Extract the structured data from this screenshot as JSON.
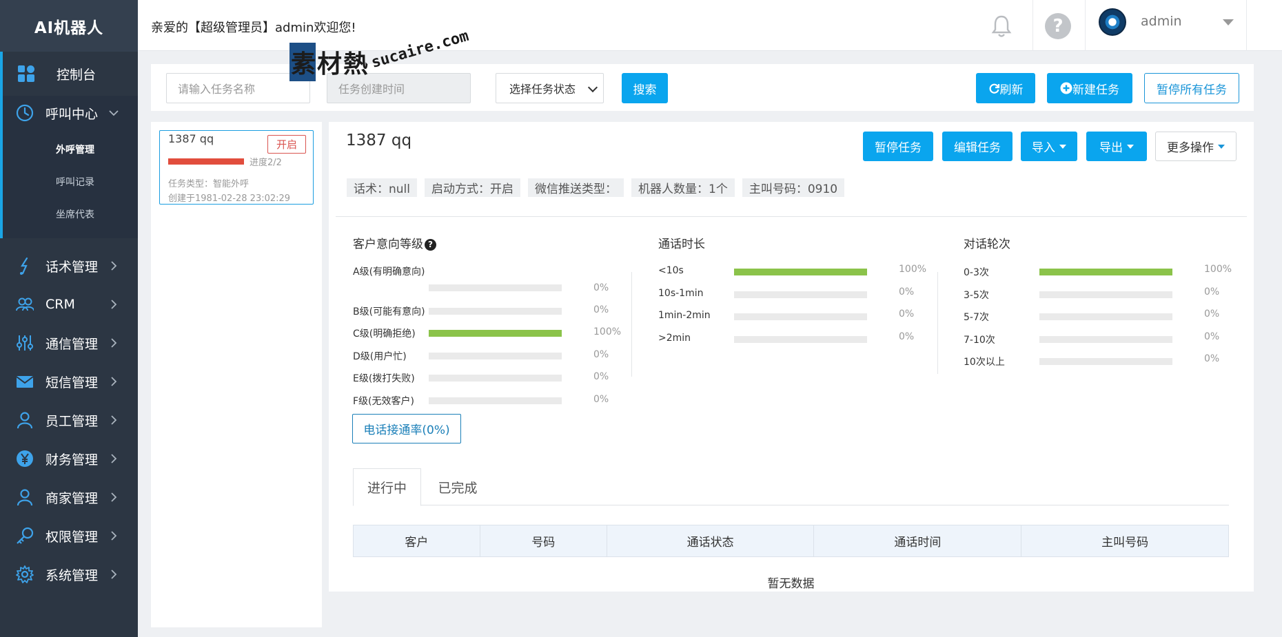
{
  "brand": "AI机器人",
  "sidebar": {
    "dashboard": "控制台",
    "call_center": "呼叫中心",
    "sub_items": [
      "外呼管理",
      "呼叫记录",
      "坐席代表"
    ],
    "items": [
      "话术管理",
      "CRM",
      "通信管理",
      "短信管理",
      "员工管理",
      "财务管理",
      "商家管理",
      "权限管理",
      "系统管理"
    ],
    "icons": [
      "script-icon",
      "crm-icon",
      "sliders-icon",
      "envelope-icon",
      "user-icon",
      "yen-icon",
      "merchant-icon",
      "key-icon",
      "gear-icon"
    ],
    "accent_color": "#1aa5e6"
  },
  "topbar": {
    "welcome": "亲爱的【超级管理员】admin欢迎您!",
    "username": "admin",
    "help_glyph": "?"
  },
  "watermark": {
    "cn": "素材熱",
    "en": "sucaire.com"
  },
  "search": {
    "task_name_placeholder": "请输入任务名称",
    "created_time_placeholder": "任务创建时间",
    "status_select": "选择任务状态",
    "search_label": "搜索",
    "refresh_label": "刷新",
    "new_task_label": "新建任务",
    "pause_all_label": "暂停所有任务"
  },
  "task_card": {
    "name": "1387 qq",
    "status": "开启",
    "progress_text": "进度2/2",
    "progress": 1.0,
    "type": "任务类型：智能外呼",
    "created": "创建于1981-02-28 23:02:29"
  },
  "task_detail": {
    "title": "1387 qq",
    "buttons": {
      "pause": "暂停任务",
      "edit": "编辑任务",
      "import": "导入",
      "export": "导出",
      "more": "更多操作"
    },
    "info": [
      "话术：null",
      "启动方式：开启",
      "微信推送类型：",
      "机器人数量：1个",
      "主叫号码：0910"
    ]
  },
  "stats": {
    "intent": {
      "title": "客户意向等级",
      "rows": [
        {
          "label": "A级(有明确意向)",
          "pct": "0%",
          "value": 0
        },
        {
          "label": "B级(可能有意向)",
          "pct": "0%",
          "value": 0
        },
        {
          "label": "C级(明确拒绝)",
          "pct": "100%",
          "value": 100
        },
        {
          "label": "D级(用户忙)",
          "pct": "0%",
          "value": 0
        },
        {
          "label": "E级(拨打失败)",
          "pct": "0%",
          "value": 0
        },
        {
          "label": "F级(无效客户)",
          "pct": "0%",
          "value": 0
        }
      ]
    },
    "duration": {
      "title": "通话时长",
      "rows": [
        {
          "label": "<10s",
          "pct": "100%",
          "value": 100
        },
        {
          "label": "10s-1min",
          "pct": "0%",
          "value": 0
        },
        {
          "label": "1min-2min",
          "pct": "0%",
          "value": 0
        },
        {
          "label": ">2min",
          "pct": "0%",
          "value": 0
        }
      ]
    },
    "rounds": {
      "title": "对话轮次",
      "rows": [
        {
          "label": "0-3次",
          "pct": "100%",
          "value": 100
        },
        {
          "label": "3-5次",
          "pct": "0%",
          "value": 0
        },
        {
          "label": "5-7次",
          "pct": "0%",
          "value": 0
        },
        {
          "label": "7-10次",
          "pct": "0%",
          "value": 0
        },
        {
          "label": "10次以上",
          "pct": "0%",
          "value": 0
        }
      ]
    },
    "bar_color": "#8bc34a",
    "connect_rate": "电话接通率(0%)"
  },
  "tabs": [
    "进行中",
    "已完成"
  ],
  "table": {
    "headers": [
      "客户",
      "号码",
      "通话状态",
      "通话时间",
      "主叫号码"
    ],
    "empty": "暂无数据"
  }
}
